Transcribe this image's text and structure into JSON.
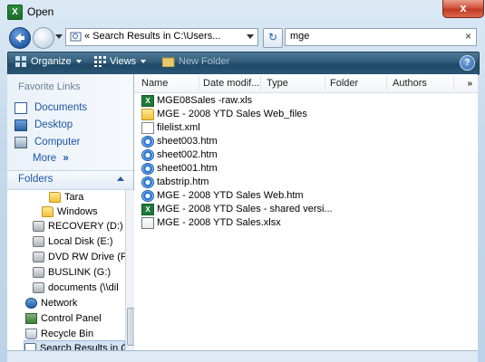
{
  "window": {
    "title": "Open",
    "close_label": "x",
    "app_icon_letter": "X"
  },
  "address_bar": {
    "path": "«  Search Results in C:\\Users...",
    "search_value": "mge",
    "clear_label": "×",
    "refresh_label": "↻"
  },
  "toolbar": {
    "organize": "Organize",
    "views": "Views",
    "new_folder": "New Folder",
    "help": "?"
  },
  "favorite_links": {
    "heading": "Favorite Links",
    "items": [
      {
        "label": "Documents",
        "icon": "documents-icon"
      },
      {
        "label": "Desktop",
        "icon": "desktop-icon"
      },
      {
        "label": "Computer",
        "icon": "computer-icon"
      }
    ],
    "more": "More",
    "more_chevron": "»"
  },
  "folders": {
    "label": "Folders",
    "tree": [
      {
        "label": "Tara",
        "icon": "folder-icon"
      },
      {
        "label": "Windows",
        "icon": "folder-icon"
      },
      {
        "label": "RECOVERY (D:)",
        "icon": "drive-icon"
      },
      {
        "label": "Local Disk (E:)",
        "icon": "drive-icon"
      },
      {
        "label": "DVD RW Drive (F",
        "icon": "dvd-drive-icon"
      },
      {
        "label": "BUSLINK (G:)",
        "icon": "drive-icon"
      },
      {
        "label": "documents (\\\\dil",
        "icon": "network-drive-icon"
      },
      {
        "label": "Network",
        "icon": "network-icon"
      },
      {
        "label": "Control Panel",
        "icon": "control-panel-icon"
      },
      {
        "label": "Recycle Bin",
        "icon": "recycle-bin-icon"
      },
      {
        "label": "Search Results in C",
        "icon": "search-folder-icon"
      }
    ]
  },
  "columns": [
    "Name",
    "Date modif...",
    "Type",
    "Folder",
    "Authors"
  ],
  "column_scroll": "»",
  "files": [
    {
      "name": "MGE08Sales -raw.xls",
      "icon": "excel-icon"
    },
    {
      "name": "MGE - 2008 YTD Sales Web_files",
      "icon": "folder-icon"
    },
    {
      "name": "filelist.xml",
      "icon": "xml-file-icon"
    },
    {
      "name": "sheet003.htm",
      "icon": "ie-html-icon"
    },
    {
      "name": "sheet002.htm",
      "icon": "ie-html-icon"
    },
    {
      "name": "sheet001.htm",
      "icon": "ie-html-icon"
    },
    {
      "name": "tabstrip.htm",
      "icon": "ie-html-icon"
    },
    {
      "name": "MGE - 2008 YTD Sales Web.htm",
      "icon": "ie-html-icon"
    },
    {
      "name": "MGE - 2008 YTD Sales - shared versi...",
      "icon": "excel-icon"
    },
    {
      "name": "MGE - 2008 YTD Sales.xlsx",
      "icon": "xlsx-icon"
    }
  ]
}
